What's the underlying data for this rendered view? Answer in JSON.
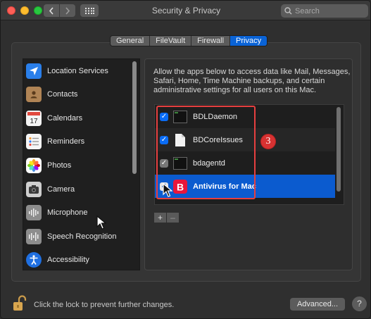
{
  "window": {
    "title": "Security & Privacy",
    "search_placeholder": "Search"
  },
  "tabs": [
    {
      "label": "General",
      "active": false
    },
    {
      "label": "FileVault",
      "active": false
    },
    {
      "label": "Firewall",
      "active": false
    },
    {
      "label": "Privacy",
      "active": true
    }
  ],
  "sidebar": {
    "items": [
      {
        "label": "Location Services",
        "icon": "location-arrow-icon"
      },
      {
        "label": "Contacts",
        "icon": "contacts-book-icon"
      },
      {
        "label": "Calendars",
        "icon": "calendar-icon"
      },
      {
        "label": "Reminders",
        "icon": "reminders-list-icon"
      },
      {
        "label": "Photos",
        "icon": "photos-flower-icon"
      },
      {
        "label": "Camera",
        "icon": "camera-icon"
      },
      {
        "label": "Microphone",
        "icon": "microphone-waveform-icon"
      },
      {
        "label": "Speech Recognition",
        "icon": "speech-waveform-icon"
      },
      {
        "label": "Accessibility",
        "icon": "accessibility-person-icon"
      }
    ]
  },
  "panel": {
    "description": "Allow the apps below to access data like Mail, Messages, Safari, Home, Time Machine backups, and certain administrative settings for all users on this Mac.",
    "apps": [
      {
        "label": "BDLDaemon",
        "checked": true,
        "icon": "terminal-exec-icon"
      },
      {
        "label": "BDCoreIssues",
        "checked": true,
        "icon": "document-file-icon"
      },
      {
        "label": "bdagentd",
        "checked": true,
        "icon": "terminal-exec-icon"
      },
      {
        "label": "Antivirus for Mac",
        "checked": true,
        "selected": true,
        "icon": "bitdefender-b-icon"
      }
    ],
    "plus_label": "+",
    "minus_label": "–",
    "annotation_number": "3"
  },
  "footer": {
    "lock_text": "Click the lock to prevent further changes.",
    "advanced_label": "Advanced...",
    "help_label": "?"
  },
  "colors": {
    "accent": "#0a63d6",
    "selection": "#0b5bcf",
    "annotation": "#e63f3f"
  }
}
